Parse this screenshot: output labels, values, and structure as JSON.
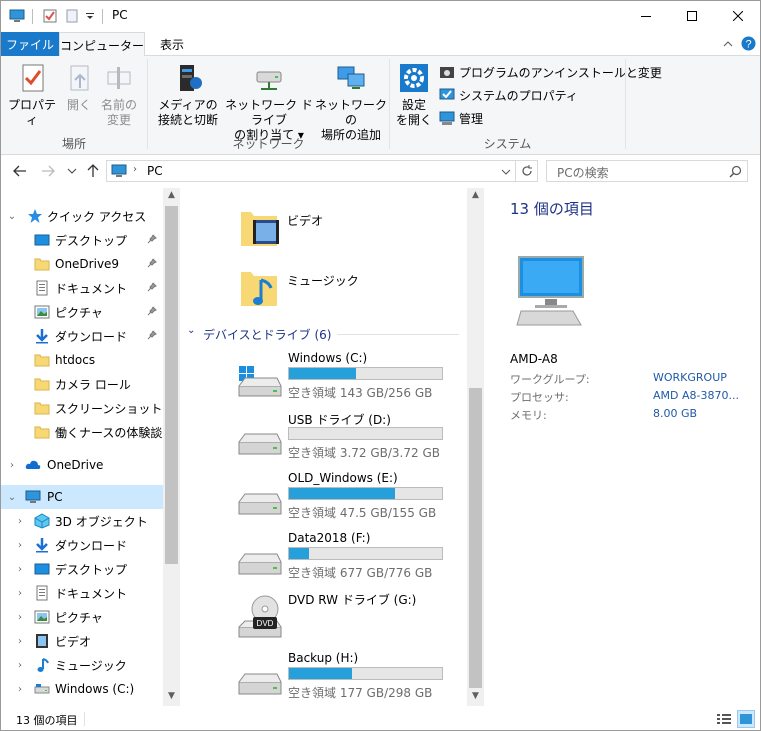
{
  "window": {
    "title": "PC",
    "controls": {
      "minimize": "—",
      "maximize": "☐",
      "close": "✕"
    }
  },
  "tabs": {
    "file": "ファイル",
    "computer": "コンピューター",
    "view": "表示"
  },
  "ribbon": {
    "location": {
      "properties": "プロパティ",
      "open": "開く",
      "rename_line1": "名前の",
      "rename_line2": "変更",
      "group_label": "場所"
    },
    "network": {
      "media_line1": "メディアの",
      "media_line2": "接続と切断",
      "map_line1": "ネットワーク ドライブ",
      "map_line2": "の割り当て",
      "add_line1": "ネットワークの",
      "add_line2": "場所の追加",
      "group_label": "ネットワーク"
    },
    "system": {
      "settings_line1": "設定",
      "settings_line2": "を開く",
      "uninstall": "プログラムのアンインストールと変更",
      "properties": "システムのプロパティ",
      "manage": "管理",
      "group_label": "システム"
    }
  },
  "address": {
    "path": "PC",
    "search_placeholder": "PCの検索"
  },
  "nav": {
    "quick_access": "クイック アクセス",
    "quick_items": [
      {
        "label": "デスクトップ",
        "icon": "desktop-icon"
      },
      {
        "label": "OneDrive9",
        "icon": "folder-icon"
      },
      {
        "label": "ドキュメント",
        "icon": "documents-icon"
      },
      {
        "label": "ピクチャ",
        "icon": "pictures-icon"
      },
      {
        "label": "ダウンロード",
        "icon": "download-icon"
      },
      {
        "label": "htdocs",
        "icon": "folder-icon"
      },
      {
        "label": "カメラ ロール",
        "icon": "folder-icon"
      },
      {
        "label": "スクリーンショット",
        "icon": "folder-icon"
      },
      {
        "label": "働くナースの体験談",
        "icon": "folder-icon"
      }
    ],
    "onedrive": "OneDrive",
    "pc": "PC",
    "pc_items": [
      {
        "label": "3D オブジェクト",
        "icon": "3d-objects-icon"
      },
      {
        "label": "ダウンロード",
        "icon": "download-icon"
      },
      {
        "label": "デスクトップ",
        "icon": "desktop-icon"
      },
      {
        "label": "ドキュメント",
        "icon": "documents-icon"
      },
      {
        "label": "ピクチャ",
        "icon": "pictures-icon"
      },
      {
        "label": "ビデオ",
        "icon": "videos-icon"
      },
      {
        "label": "ミュージック",
        "icon": "music-icon"
      },
      {
        "label": "Windows (C:)",
        "icon": "drive-icon"
      }
    ]
  },
  "content": {
    "video": "ビデオ",
    "music": "ミュージック",
    "devices_header": "デバイスとドライブ (6)",
    "drives": [
      {
        "name": "Windows (C:)",
        "free": "空き領域 143 GB/256 GB",
        "used_fraction": 0.44,
        "icon": "windows-drive-icon"
      },
      {
        "name": "USB ドライブ (D:)",
        "free": "空き領域 3.72 GB/3.72 GB",
        "used_fraction": 0.0,
        "icon": "drive-icon"
      },
      {
        "name": "OLD_Windows (E:)",
        "free": "空き領域 47.5 GB/155 GB",
        "used_fraction": 0.69,
        "icon": "drive-icon"
      },
      {
        "name": "Data2018 (F:)",
        "free": "空き領域 677 GB/776 GB",
        "used_fraction": 0.13,
        "icon": "drive-icon"
      },
      {
        "name": "DVD RW ドライブ (G:)",
        "free": "",
        "used_fraction": null,
        "icon": "dvd-drive-icon"
      },
      {
        "name": "Backup (H:)",
        "free": "空き領域 177 GB/298 GB",
        "used_fraction": 0.41,
        "icon": "drive-icon"
      }
    ]
  },
  "details": {
    "count": "13 個の項目",
    "name": "AMD-A8",
    "rows": [
      {
        "label": "ワークグループ:",
        "value": "WORKGROUP"
      },
      {
        "label": "プロセッサ:",
        "value": "AMD A8-3870..."
      },
      {
        "label": "メモリ:",
        "value": "8.00 GB"
      }
    ]
  },
  "status": {
    "count": "13 個の項目"
  },
  "colors": {
    "accent": "#1979ca",
    "selection": "#cce8ff",
    "bar": "#26a0da"
  }
}
